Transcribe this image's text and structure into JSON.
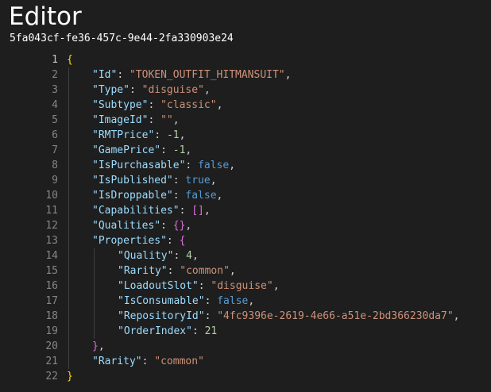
{
  "header": {
    "title": "Editor",
    "document_id": "5fa043cf-fe36-457c-9e44-2fa330903e24"
  },
  "editor": {
    "active_line": 1,
    "lines": [
      {
        "n": "1",
        "indent": 0,
        "parts": [
          {
            "t": "{",
            "c": "br1"
          }
        ]
      },
      {
        "n": "2",
        "indent": 1,
        "parts": [
          {
            "t": "\"Id\"",
            "c": "k"
          },
          {
            "t": ": ",
            "c": "p"
          },
          {
            "t": "\"TOKEN_OUTFIT_HITMANSUIT\"",
            "c": "s"
          },
          {
            "t": ",",
            "c": "p"
          }
        ]
      },
      {
        "n": "3",
        "indent": 1,
        "parts": [
          {
            "t": "\"Type\"",
            "c": "k"
          },
          {
            "t": ": ",
            "c": "p"
          },
          {
            "t": "\"disguise\"",
            "c": "s"
          },
          {
            "t": ",",
            "c": "p"
          }
        ]
      },
      {
        "n": "4",
        "indent": 1,
        "parts": [
          {
            "t": "\"Subtype\"",
            "c": "k"
          },
          {
            "t": ": ",
            "c": "p"
          },
          {
            "t": "\"classic\"",
            "c": "s"
          },
          {
            "t": ",",
            "c": "p"
          }
        ]
      },
      {
        "n": "5",
        "indent": 1,
        "parts": [
          {
            "t": "\"ImageId\"",
            "c": "k"
          },
          {
            "t": ": ",
            "c": "p"
          },
          {
            "t": "\"\"",
            "c": "s"
          },
          {
            "t": ",",
            "c": "p"
          }
        ]
      },
      {
        "n": "6",
        "indent": 1,
        "parts": [
          {
            "t": "\"RMTPrice\"",
            "c": "k"
          },
          {
            "t": ": ",
            "c": "p"
          },
          {
            "t": "-1",
            "c": "n"
          },
          {
            "t": ",",
            "c": "p"
          }
        ]
      },
      {
        "n": "7",
        "indent": 1,
        "parts": [
          {
            "t": "\"GamePrice\"",
            "c": "k"
          },
          {
            "t": ": ",
            "c": "p"
          },
          {
            "t": "-1",
            "c": "n"
          },
          {
            "t": ",",
            "c": "p"
          }
        ]
      },
      {
        "n": "8",
        "indent": 1,
        "parts": [
          {
            "t": "\"IsPurchasable\"",
            "c": "k"
          },
          {
            "t": ": ",
            "c": "p"
          },
          {
            "t": "false",
            "c": "b"
          },
          {
            "t": ",",
            "c": "p"
          }
        ]
      },
      {
        "n": "9",
        "indent": 1,
        "parts": [
          {
            "t": "\"IsPublished\"",
            "c": "k"
          },
          {
            "t": ": ",
            "c": "p"
          },
          {
            "t": "true",
            "c": "b"
          },
          {
            "t": ",",
            "c": "p"
          }
        ]
      },
      {
        "n": "10",
        "indent": 1,
        "parts": [
          {
            "t": "\"IsDroppable\"",
            "c": "k"
          },
          {
            "t": ": ",
            "c": "p"
          },
          {
            "t": "false",
            "c": "b"
          },
          {
            "t": ",",
            "c": "p"
          }
        ]
      },
      {
        "n": "11",
        "indent": 1,
        "parts": [
          {
            "t": "\"Capabilities\"",
            "c": "k"
          },
          {
            "t": ": ",
            "c": "p"
          },
          {
            "t": "[]",
            "c": "br2"
          },
          {
            "t": ",",
            "c": "p"
          }
        ]
      },
      {
        "n": "12",
        "indent": 1,
        "parts": [
          {
            "t": "\"Qualities\"",
            "c": "k"
          },
          {
            "t": ": ",
            "c": "p"
          },
          {
            "t": "{}",
            "c": "br2"
          },
          {
            "t": ",",
            "c": "p"
          }
        ]
      },
      {
        "n": "13",
        "indent": 1,
        "parts": [
          {
            "t": "\"Properties\"",
            "c": "k"
          },
          {
            "t": ": ",
            "c": "p"
          },
          {
            "t": "{",
            "c": "br2"
          }
        ]
      },
      {
        "n": "14",
        "indent": 2,
        "parts": [
          {
            "t": "\"Quality\"",
            "c": "k"
          },
          {
            "t": ": ",
            "c": "p"
          },
          {
            "t": "4",
            "c": "n"
          },
          {
            "t": ",",
            "c": "p"
          }
        ]
      },
      {
        "n": "15",
        "indent": 2,
        "parts": [
          {
            "t": "\"Rarity\"",
            "c": "k"
          },
          {
            "t": ": ",
            "c": "p"
          },
          {
            "t": "\"common\"",
            "c": "s"
          },
          {
            "t": ",",
            "c": "p"
          }
        ]
      },
      {
        "n": "16",
        "indent": 2,
        "parts": [
          {
            "t": "\"LoadoutSlot\"",
            "c": "k"
          },
          {
            "t": ": ",
            "c": "p"
          },
          {
            "t": "\"disguise\"",
            "c": "s"
          },
          {
            "t": ",",
            "c": "p"
          }
        ]
      },
      {
        "n": "17",
        "indent": 2,
        "parts": [
          {
            "t": "\"IsConsumable\"",
            "c": "k"
          },
          {
            "t": ": ",
            "c": "p"
          },
          {
            "t": "false",
            "c": "b"
          },
          {
            "t": ",",
            "c": "p"
          }
        ]
      },
      {
        "n": "18",
        "indent": 2,
        "parts": [
          {
            "t": "\"RepositoryId\"",
            "c": "k"
          },
          {
            "t": ": ",
            "c": "p"
          },
          {
            "t": "\"4fc9396e-2619-4e66-a51e-2bd366230da7\"",
            "c": "s"
          },
          {
            "t": ",",
            "c": "p"
          }
        ]
      },
      {
        "n": "19",
        "indent": 2,
        "parts": [
          {
            "t": "\"OrderIndex\"",
            "c": "k"
          },
          {
            "t": ": ",
            "c": "p"
          },
          {
            "t": "21",
            "c": "n"
          }
        ]
      },
      {
        "n": "20",
        "indent": 1,
        "parts": [
          {
            "t": "}",
            "c": "br2"
          },
          {
            "t": ",",
            "c": "p"
          }
        ]
      },
      {
        "n": "21",
        "indent": 1,
        "parts": [
          {
            "t": "\"Rarity\"",
            "c": "k"
          },
          {
            "t": ": ",
            "c": "p"
          },
          {
            "t": "\"common\"",
            "c": "s"
          }
        ]
      },
      {
        "n": "22",
        "indent": 0,
        "parts": [
          {
            "t": "}",
            "c": "br1"
          }
        ]
      }
    ]
  }
}
